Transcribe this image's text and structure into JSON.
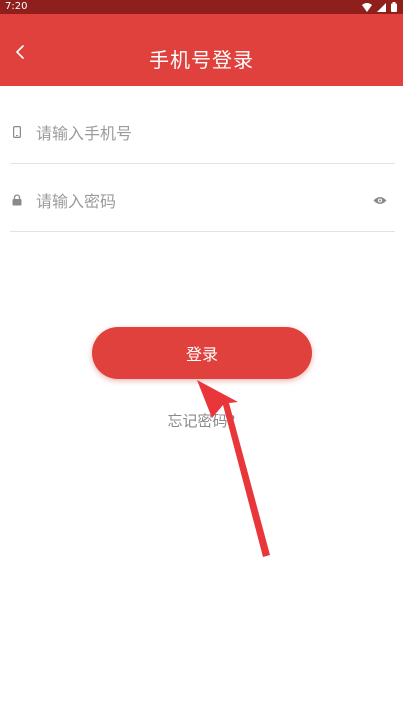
{
  "status_bar": {
    "time": "7:20",
    "icons": [
      "wifi-icon",
      "signal-icon",
      "battery-icon"
    ]
  },
  "header": {
    "title": "手机号登录",
    "back_icon": "chevron-left-icon"
  },
  "form": {
    "phone": {
      "icon": "phone-icon",
      "placeholder": "请输入手机号",
      "value": ""
    },
    "password": {
      "icon": "lock-icon",
      "placeholder": "请输入密码",
      "value": "",
      "toggle_icon": "eye-icon"
    }
  },
  "login_button": {
    "label": "登录"
  },
  "forgot_password": {
    "label": "忘记密码?"
  },
  "colors": {
    "primary": "#e0413c",
    "status_bar": "#8e1f1d",
    "placeholder": "#9b9b9b",
    "link": "#8a8a8a",
    "divider": "#e2e2e2"
  }
}
